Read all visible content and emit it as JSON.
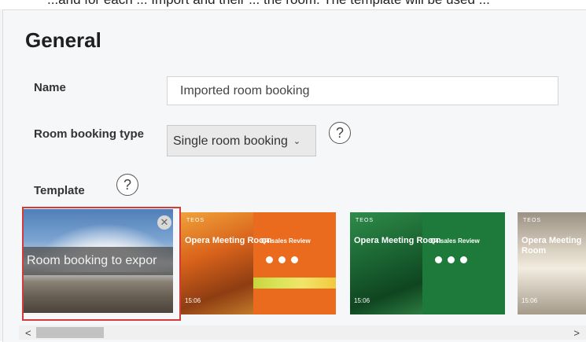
{
  "header_fragment": "...and for each ... Import and their ... the room. The template will be used ...",
  "section": {
    "title": "General"
  },
  "fields": {
    "name_label": "Name",
    "name_value": "Imported room booking",
    "type_label": "Room booking type",
    "type_value": "Single room booking",
    "template_label": "Template"
  },
  "help_glyph": "?",
  "templates": {
    "selected_overlay": "Room booking to expor",
    "close_glyph": "✕",
    "room_title": "Opera Meeting Room",
    "logo_text": "TEOS",
    "meeting_title": "Q4 sales Review",
    "clock": "15:06"
  },
  "scroll": {
    "left_arrow": "<",
    "right_arrow": ">"
  }
}
